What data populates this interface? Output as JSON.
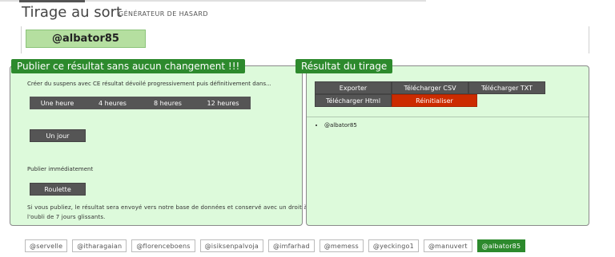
{
  "header": {
    "title": "Tirage au sort",
    "subtitle": "GÉNÉRATEUR DE HASARD"
  },
  "winner": "@albator85",
  "publish_panel": {
    "tab_label": "Publier ce résultat sans aucun changement !!!",
    "intro": "Créer du suspens avec CE résultat dévoilé progressivement puis définitivement dans...",
    "delays": [
      "Une heure",
      "4 heures",
      "8 heures",
      "12 heures"
    ],
    "day_button": "Un jour",
    "immediate_label": "Publier immédiatement",
    "roulette_button": "Roulette",
    "note": "Si vous publiez, le résultat sera envoyé vers notre base de données et conservé avec un droit à l'oubli de 7 jours glissants."
  },
  "result_panel": {
    "tab_label": "Résultat du tirage",
    "actions": {
      "export": "Exporter",
      "csv": "Télécharger CSV",
      "txt": "Télécharger TXT",
      "html": "Télécharger Html",
      "reset": "Réinitialiser"
    },
    "results": [
      "@albator85"
    ]
  },
  "participants": [
    "@servelle",
    "@itharagaian",
    "@florenceboens",
    "@isiksenpalvoja",
    "@imfarhad",
    "@memess",
    "@yeckingo1",
    "@manuvert",
    "@albator85"
  ],
  "selected_participant": "@albator85",
  "colors": {
    "accent": "#2d8a2d",
    "panel_bg": "#ddfadb",
    "button": "#555555",
    "danger": "#cc2b00"
  }
}
